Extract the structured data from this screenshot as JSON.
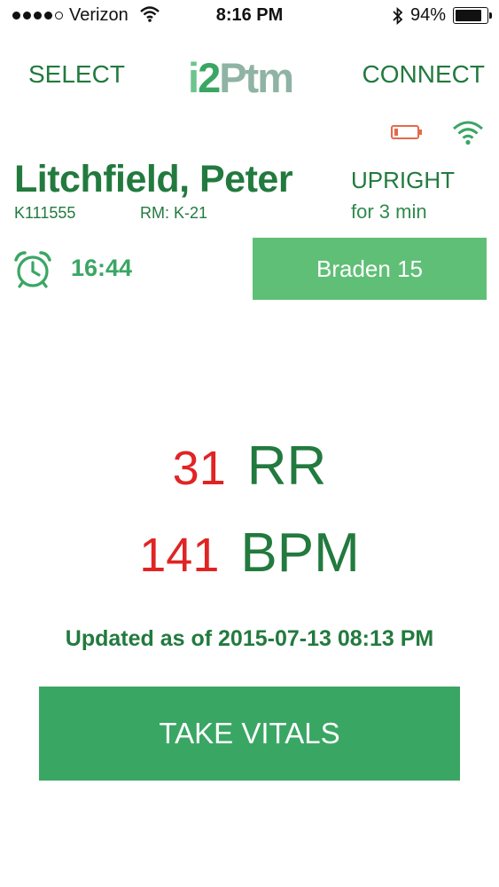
{
  "status_bar": {
    "carrier": "Verizon",
    "time": "8:16 PM",
    "battery": "94%",
    "battery_level": 0.94,
    "icons": [
      "signal-dots-icon",
      "wifi-icon",
      "bluetooth-icon",
      "battery-icon"
    ]
  },
  "nav": {
    "select_label": "SELECT",
    "connect_label": "CONNECT",
    "logo": "i2Ptm"
  },
  "device": {
    "icons": [
      "device-battery-low-icon",
      "device-wifi-icon"
    ],
    "battery_color": "#e46a4a"
  },
  "patient": {
    "name": "Litchfield, Peter",
    "id": "K111555",
    "room": "RM: K-21",
    "position": "UPRIGHT",
    "position_duration": "for 3 min"
  },
  "timer": {
    "icon": "alarm-clock-icon",
    "value": "16:44"
  },
  "braden_label": "Braden 15",
  "vitals": {
    "rr_value": "31",
    "rr_unit": "RR",
    "bpm_value": "141",
    "bpm_unit": "BPM"
  },
  "updated_text": "Updated as of 2015-07-13 08:13 PM",
  "take_vitals_label": "TAKE VITALS",
  "colors": {
    "primary_green": "#227a3e",
    "button_green": "#3aa664",
    "light_button_green": "#5fbf76",
    "alert_red": "#e02424"
  }
}
